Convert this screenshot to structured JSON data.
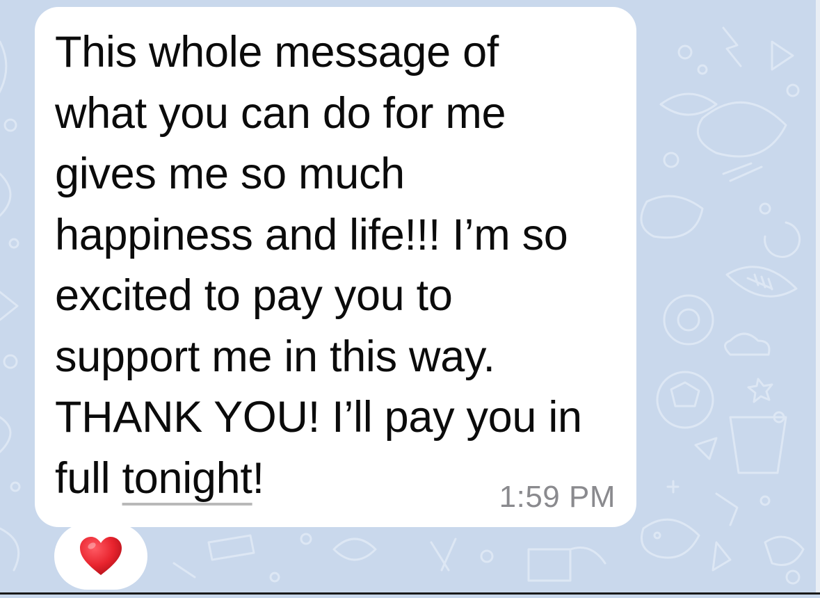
{
  "message": {
    "lines": [
      "This whole message of",
      "what you can do for me",
      "gives me so much",
      "happiness and life!!! I’m so",
      "excited to pay you to",
      "support me in this way.",
      "THANK YOU! I’ll pay you in"
    ],
    "last_line_prefix": "full ",
    "detected_word": "tonight",
    "last_line_suffix": "!",
    "time": "1:59 PM"
  },
  "reaction": {
    "emoji": "heart-icon",
    "color": "#e8242e"
  },
  "colors": {
    "chat_background": "#c9d8ec",
    "bubble": "#ffffff",
    "text": "#0b0b0b",
    "timestamp": "#8a8a8e"
  }
}
